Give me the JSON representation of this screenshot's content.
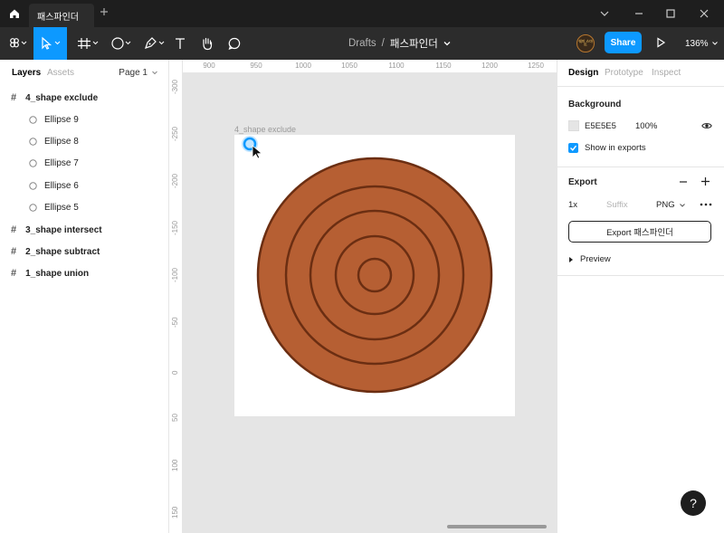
{
  "titlebar": {
    "tab_title": "패스파인더",
    "tab_close": "×",
    "tab_add": "+"
  },
  "toolbar": {
    "breadcrumb_root": "Drafts",
    "breadcrumb_sep": "/",
    "file_name": "패스파인더",
    "avatar_text": "쉐미 스마트",
    "share_label": "Share",
    "zoom_level": "136%",
    "active_tool": "move"
  },
  "left_panel": {
    "tabs": [
      "Layers",
      "Assets"
    ],
    "active_tab": "Layers",
    "page_label": "Page 1",
    "layers": [
      {
        "name": "4_shape exclude",
        "type": "frame"
      },
      {
        "name": "Ellipse 9",
        "type": "ellipse"
      },
      {
        "name": "Ellipse 8",
        "type": "ellipse"
      },
      {
        "name": "Ellipse 7",
        "type": "ellipse"
      },
      {
        "name": "Ellipse 6",
        "type": "ellipse"
      },
      {
        "name": "Ellipse 5",
        "type": "ellipse"
      },
      {
        "name": "3_shape intersect",
        "type": "frame"
      },
      {
        "name": "2_shape subtract",
        "type": "frame"
      },
      {
        "name": "1_shape union",
        "type": "frame"
      }
    ]
  },
  "canvas": {
    "ruler_top_labels": [
      "900",
      "950",
      "1000",
      "1050",
      "1100",
      "1150",
      "1200",
      "1250"
    ],
    "ruler_left_labels": [
      "-300",
      "-250",
      "-200",
      "-150",
      "-100",
      "-50",
      "0",
      "50",
      "100",
      "150"
    ],
    "frame_label": "4_shape exclude",
    "shape_fill": "#b65f33",
    "shape_stroke": "#6b2e12"
  },
  "right_panel": {
    "tabs": [
      "Design",
      "Prototype",
      "Inspect"
    ],
    "active_tab": "Design",
    "background_title": "Background",
    "background_hex": "E5E5E5",
    "background_opacity": "100%",
    "show_in_exports": "Show in exports",
    "export_title": "Export",
    "export_scale": "1x",
    "export_suffix_placeholder": "Suffix",
    "export_format": "PNG",
    "export_button": "Export 패스파인더",
    "preview_label": "Preview"
  },
  "help": "?",
  "colors": {
    "accent": "#0d99ff",
    "titlebar": "#1e1e1e",
    "toolbar": "#2c2c2c"
  }
}
